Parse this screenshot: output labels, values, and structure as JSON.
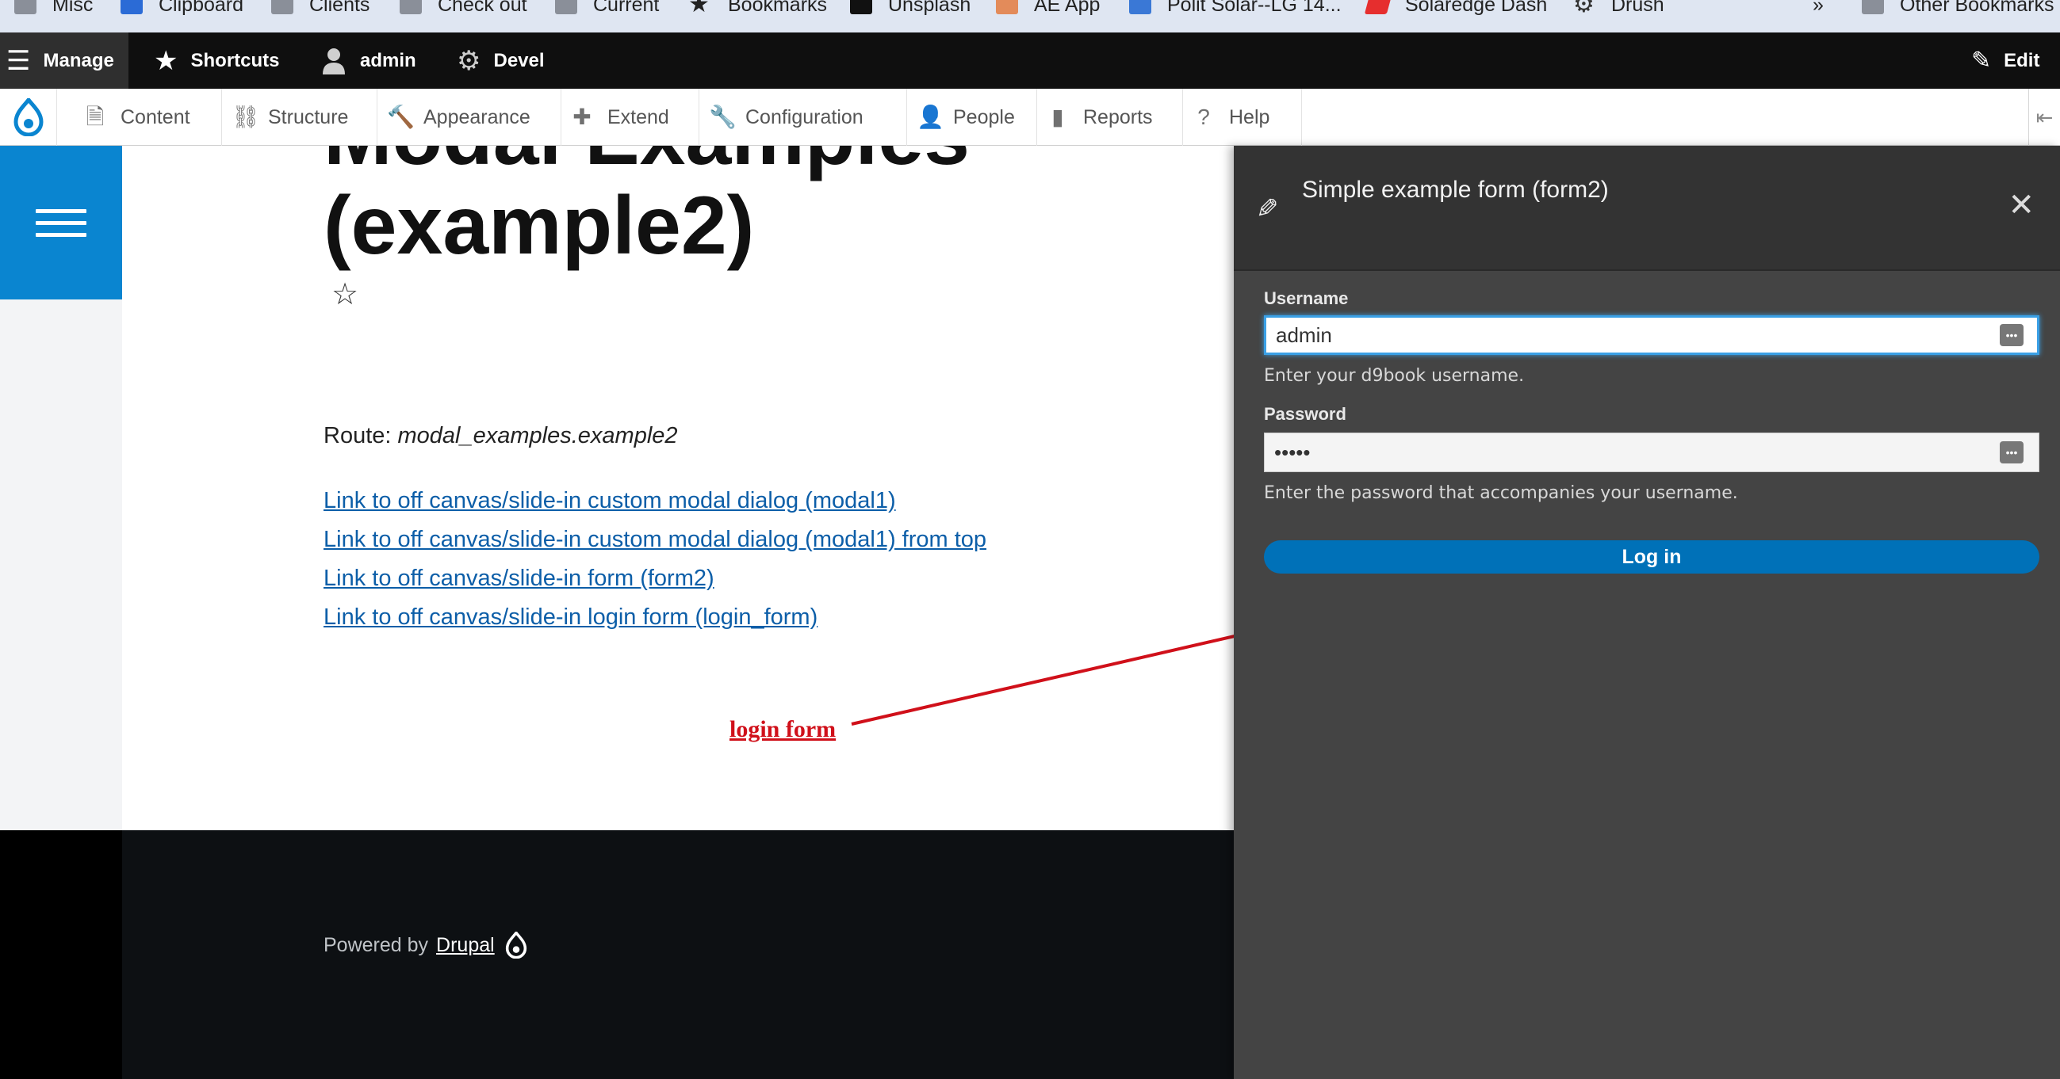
{
  "bookmarks": [
    "Misc",
    "Clipboard",
    "Clients",
    "Check out",
    "Current",
    "Bookmarks",
    "Unsplash",
    "AE App",
    "Polit Solar--LG 14...",
    "Solaredge Dash",
    "Drush",
    "»",
    "Other Bookmarks"
  ],
  "toolbar": {
    "manage": "Manage",
    "shortcuts": "Shortcuts",
    "user": "admin",
    "devel": "Devel",
    "edit": "Edit"
  },
  "tray": [
    "Content",
    "Structure",
    "Appearance",
    "Extend",
    "Configuration",
    "People",
    "Reports",
    "Help"
  ],
  "page": {
    "title_line1": "Modal Examples",
    "title_line2": "(example2)",
    "route_label": "Route:",
    "route_value": "modal_examples.example2",
    "links": [
      "Link to off canvas/slide-in custom modal dialog (modal1)",
      "Link to off canvas/slide-in custom modal dialog (modal1) from top",
      "Link to off canvas/slide-in form (form2)",
      "Link to off canvas/slide-in login form (login_form)"
    ],
    "annotation": "login form",
    "powered_by": "Powered by",
    "powered_link": "Drupal"
  },
  "dialog": {
    "title": "Simple example form (form2)",
    "username_label": "Username",
    "username_value": "admin",
    "username_desc": "Enter your d9book username.",
    "password_label": "Password",
    "password_value": "•••••",
    "password_desc": "Enter the password that accompanies your username.",
    "submit": "Log in"
  },
  "colors": {
    "toolbar_bg": "#0f0f0f",
    "accent": "#0a85d0",
    "link": "#0c5ea8",
    "annotation": "#d0101a",
    "dialog_bg": "#444444",
    "button": "#0071b8"
  }
}
